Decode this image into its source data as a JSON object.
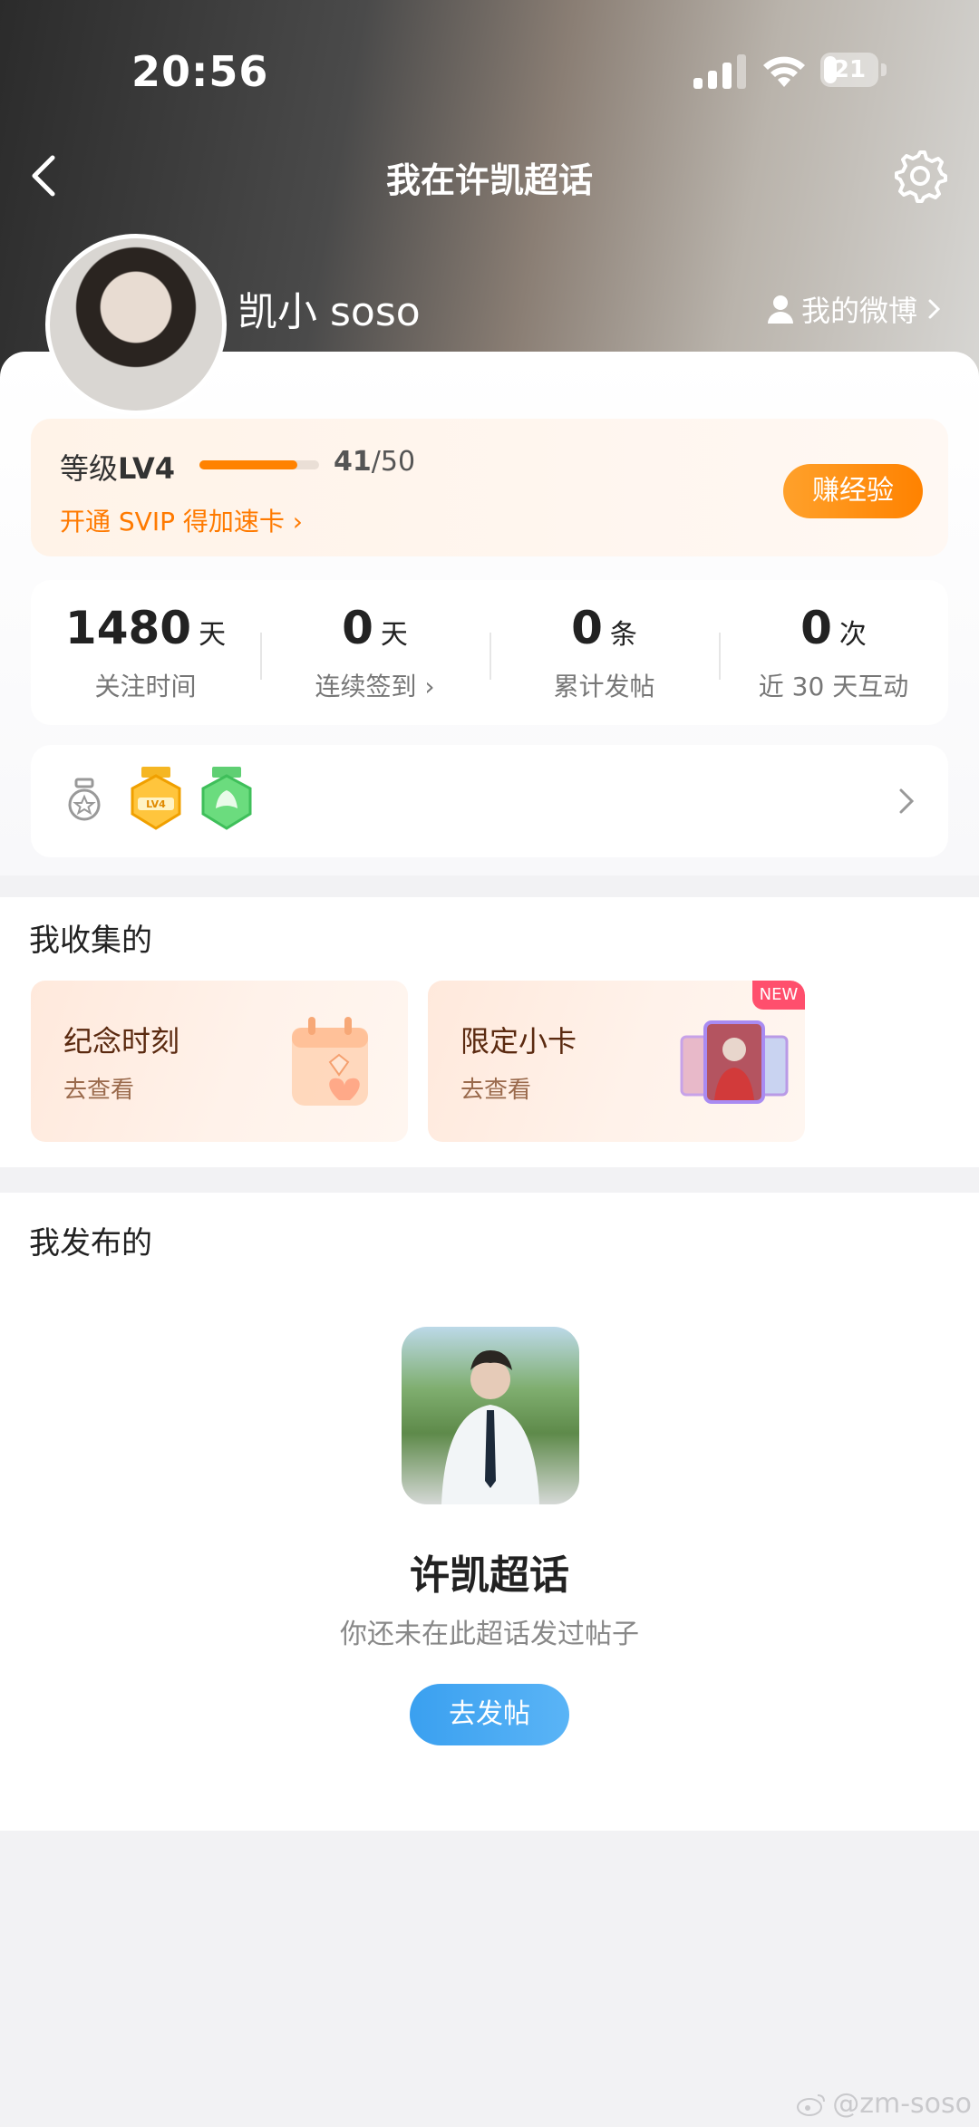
{
  "status_bar": {
    "time": "20:56",
    "battery": "21"
  },
  "nav": {
    "title": "我在许凯超话"
  },
  "profile": {
    "name": "凯小 soso",
    "my_weibo": "我的微博"
  },
  "level": {
    "label_prefix": "等级",
    "level": "LV4",
    "exp_current": "41",
    "exp_total": "/50",
    "progress": 0.82,
    "svip_link": "开通 SVIP 得加速卡",
    "earn_button": "赚经验"
  },
  "stats": [
    {
      "value": "1480",
      "unit": "天",
      "label": "关注时间"
    },
    {
      "value": "0",
      "unit": "天",
      "label": "连续签到"
    },
    {
      "value": "0",
      "unit": "条",
      "label": "累计发帖"
    },
    {
      "value": "0",
      "unit": "次",
      "label": "近 30 天互动"
    }
  ],
  "badges": {
    "badge1_text": "LV4"
  },
  "collected": {
    "title": "我收集的",
    "cards": [
      {
        "title": "纪念时刻",
        "sub": "去查看"
      },
      {
        "title": "限定小卡",
        "sub": "去查看",
        "tag": "NEW"
      }
    ]
  },
  "published": {
    "title": "我发布的",
    "topic_name": "许凯超话",
    "empty_text": "你还未在此超话发过帖子",
    "post_button": "去发帖"
  },
  "watermark": "@zm-soso",
  "colors": {
    "accent_orange": "#ff8200",
    "accent_blue": "#3aa0f0"
  }
}
